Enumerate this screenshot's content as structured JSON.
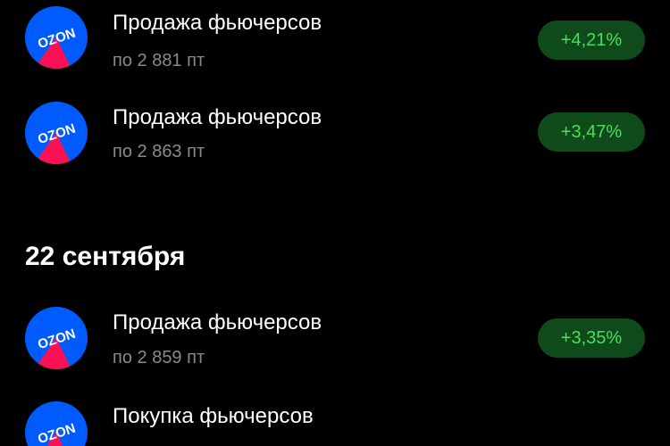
{
  "colors": {
    "background": "#000000",
    "badge_bg": "#0e4a1a",
    "badge_text": "#4cdd5e",
    "ozon_blue": "#005bff",
    "ozon_pink": "#f91155",
    "secondary_text": "#8a8a8e"
  },
  "sections": [
    {
      "date": "",
      "items": [
        {
          "logo_text": "OZON",
          "icon": "ozon-logo-icon",
          "title": "Продажа фьючерсов",
          "subtitle": "по 2 881 пт",
          "change": "+4,21%"
        },
        {
          "logo_text": "OZON",
          "icon": "ozon-logo-icon",
          "title": "Продажа фьючерсов",
          "subtitle": "по 2 863 пт",
          "change": "+3,47%"
        }
      ]
    },
    {
      "date": "22 сентября",
      "items": [
        {
          "logo_text": "OZON",
          "icon": "ozon-logo-icon",
          "title": "Продажа фьючерсов",
          "subtitle": "по 2 859 пт",
          "change": "+3,35%"
        },
        {
          "logo_text": "OZON",
          "icon": "ozon-logo-icon",
          "title": "Покупка фьючерсов",
          "subtitle": "",
          "change": ""
        }
      ]
    }
  ]
}
